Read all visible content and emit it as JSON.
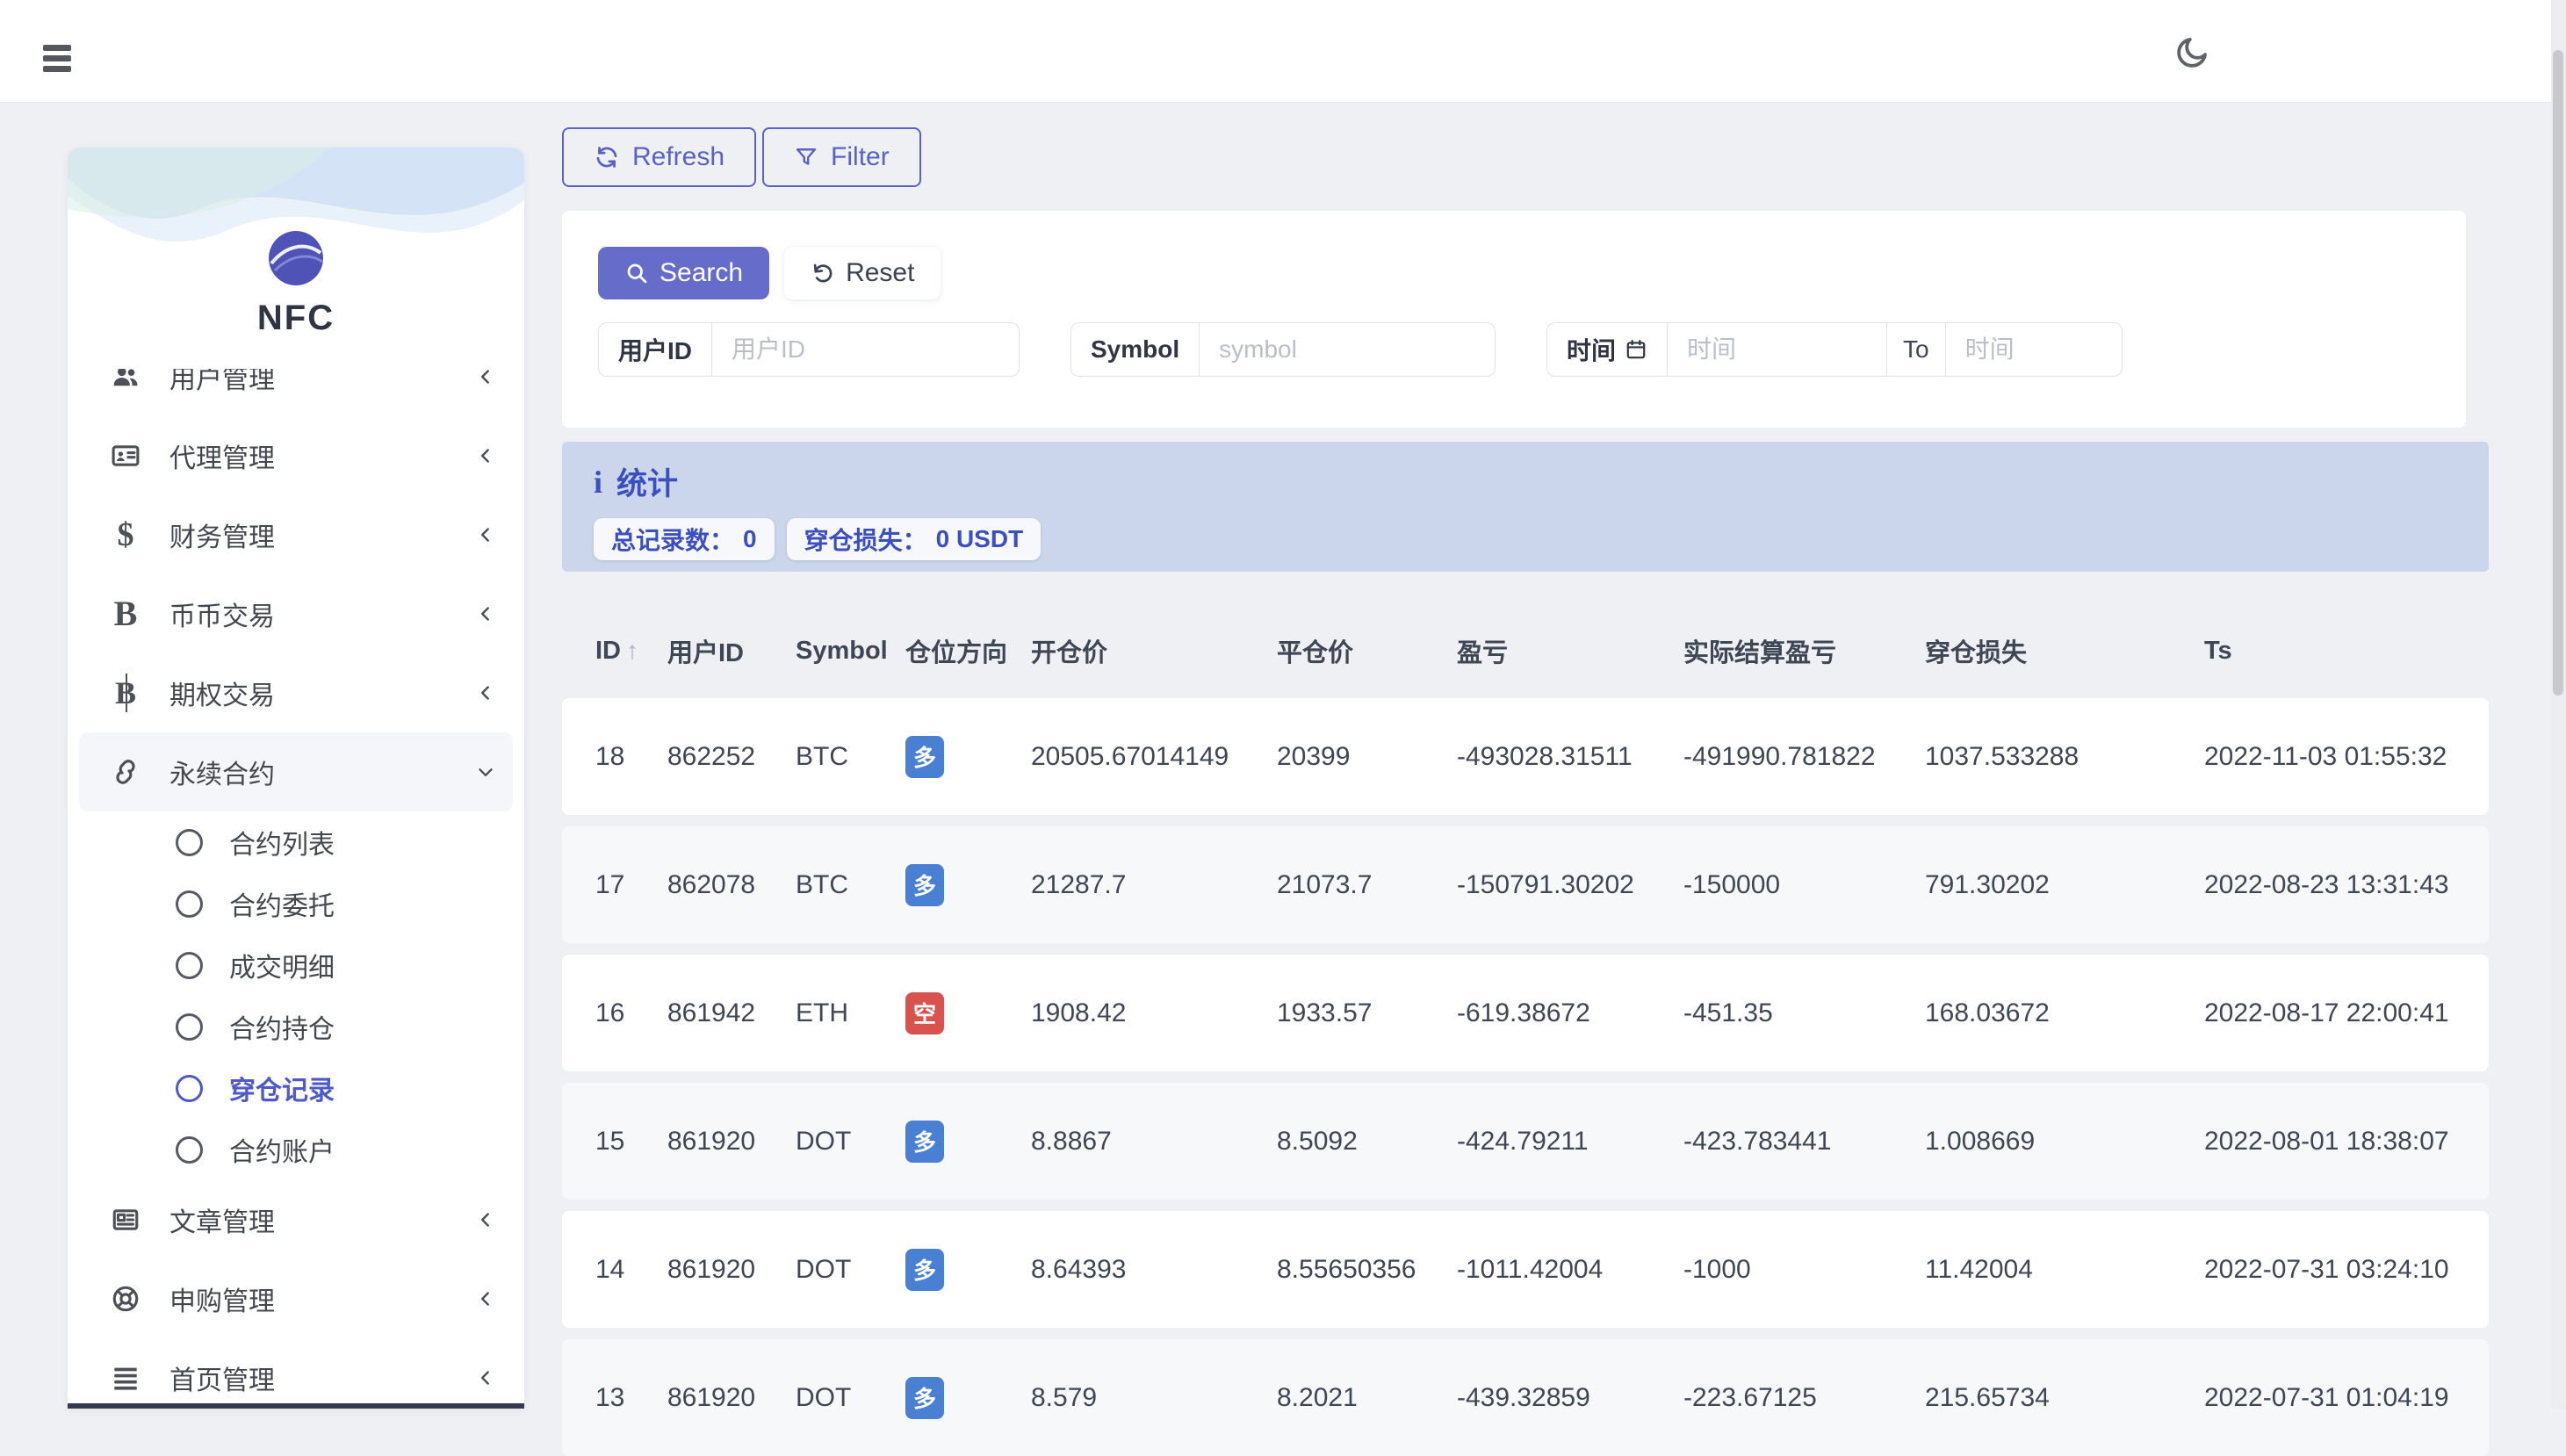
{
  "topbar": {
    "theme_icon": "moon-icon",
    "menu_icon": "hamburger-icon"
  },
  "sidebar": {
    "logo_text": "NFC",
    "menu": [
      {
        "key": "users",
        "label": "用户管理",
        "icon": "users-icon",
        "chevron": "left",
        "clipped": true
      },
      {
        "key": "agents",
        "label": "代理管理",
        "icon": "id-card-icon",
        "chevron": "left"
      },
      {
        "key": "finance",
        "label": "财务管理",
        "icon": "dollar-icon",
        "chevron": "left"
      },
      {
        "key": "spot",
        "label": "币币交易",
        "icon": "bitcoin-icon",
        "chevron": "left"
      },
      {
        "key": "options",
        "label": "期权交易",
        "icon": "baht-icon",
        "chevron": "left"
      },
      {
        "key": "perpetual",
        "label": "永续合约",
        "icon": "link-icon",
        "chevron": "down",
        "expanded": true,
        "children": [
          {
            "key": "contract-list",
            "label": "合约列表",
            "active": false
          },
          {
            "key": "contract-orders",
            "label": "合约委托",
            "active": false
          },
          {
            "key": "trade-details",
            "label": "成交明细",
            "active": false
          },
          {
            "key": "contract-positions",
            "label": "合约持仓",
            "active": false
          },
          {
            "key": "liquidation-records",
            "label": "穿仓记录",
            "active": true
          },
          {
            "key": "contract-accounts",
            "label": "合约账户",
            "active": false
          }
        ]
      },
      {
        "key": "articles",
        "label": "文章管理",
        "icon": "newspaper-icon",
        "chevron": "left"
      },
      {
        "key": "subscribe",
        "label": "申购管理",
        "icon": "life-ring-icon",
        "chevron": "left"
      },
      {
        "key": "homepage",
        "label": "首页管理",
        "icon": "list-icon",
        "chevron": "left"
      }
    ]
  },
  "toolbar": {
    "refresh_label": "Refresh",
    "filter_label": "Filter"
  },
  "filter_panel": {
    "search_label": "Search",
    "reset_label": "Reset",
    "user_id": {
      "label": "用户ID",
      "value": "",
      "placeholder": "用户ID"
    },
    "symbol": {
      "label": "Symbol",
      "value": "",
      "placeholder": "symbol"
    },
    "time": {
      "label": "时间",
      "icon": "calendar-icon",
      "from_value": "",
      "from_placeholder": "时间",
      "separator": "To",
      "to_value": "",
      "to_placeholder": "时间"
    }
  },
  "stats": {
    "title": "统计",
    "icon": "info-icon",
    "badges": [
      {
        "label": "总记录数：",
        "value": "0"
      },
      {
        "label": "穿仓损失：",
        "value": "0 USDT"
      }
    ]
  },
  "table": {
    "columns": [
      "ID",
      "用户ID",
      "Symbol",
      "仓位方向",
      "开仓价",
      "平仓价",
      "盈亏",
      "实际结算盈亏",
      "穿仓损失",
      "Ts"
    ],
    "sorted_column": "ID",
    "rows": [
      {
        "id": "18",
        "user_id": "862252",
        "symbol": "BTC",
        "side": "long",
        "side_label": "多",
        "open_price": "20505.67014149",
        "close_price": "20399",
        "pnl": "-493028.31511",
        "settled_pnl": "-491990.781822",
        "loss": "1037.533288",
        "ts": "2022-11-03 01:55:32"
      },
      {
        "id": "17",
        "user_id": "862078",
        "symbol": "BTC",
        "side": "long",
        "side_label": "多",
        "open_price": "21287.7",
        "close_price": "21073.7",
        "pnl": "-150791.30202",
        "settled_pnl": "-150000",
        "loss": "791.30202",
        "ts": "2022-08-23 13:31:43"
      },
      {
        "id": "16",
        "user_id": "861942",
        "symbol": "ETH",
        "side": "short",
        "side_label": "空",
        "open_price": "1908.42",
        "close_price": "1933.57",
        "pnl": "-619.38672",
        "settled_pnl": "-451.35",
        "loss": "168.03672",
        "ts": "2022-08-17 22:00:41"
      },
      {
        "id": "15",
        "user_id": "861920",
        "symbol": "DOT",
        "side": "long",
        "side_label": "多",
        "open_price": "8.8867",
        "close_price": "8.5092",
        "pnl": "-424.79211",
        "settled_pnl": "-423.783441",
        "loss": "1.008669",
        "ts": "2022-08-01 18:38:07"
      },
      {
        "id": "14",
        "user_id": "861920",
        "symbol": "DOT",
        "side": "long",
        "side_label": "多",
        "open_price": "8.64393",
        "close_price": "8.55650356",
        "pnl": "-1011.42004",
        "settled_pnl": "-1000",
        "loss": "11.42004",
        "ts": "2022-07-31 03:24:10"
      },
      {
        "id": "13",
        "user_id": "861920",
        "symbol": "DOT",
        "side": "long",
        "side_label": "多",
        "open_price": "8.579",
        "close_price": "8.2021",
        "pnl": "-439.32859",
        "settled_pnl": "-223.67125",
        "loss": "215.65734",
        "ts": "2022-07-31 01:04:19"
      }
    ]
  },
  "colors": {
    "accent": "#5a62c8",
    "primary_button": "#656cc9",
    "active_menu": "#4d5ac8",
    "stats_bg": "#cbd5eb",
    "stats_text": "#3b4fc0",
    "long_badge": "#4a80d4",
    "short_badge": "#d8534e",
    "page_bg": "#eef0f4"
  }
}
